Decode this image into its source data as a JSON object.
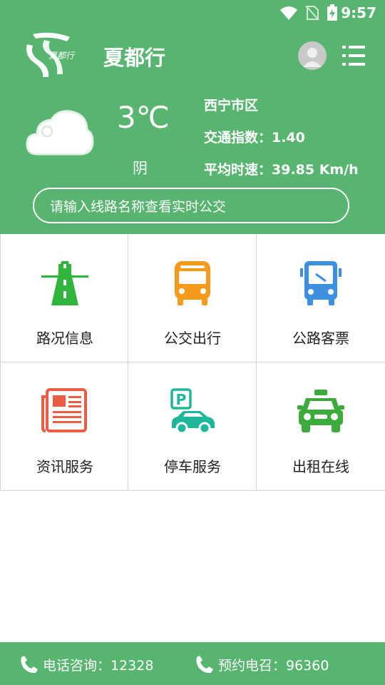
{
  "status_bar": {
    "time": "9:57"
  },
  "app": {
    "title": "夏都行",
    "logo_text": "夏都行"
  },
  "weather": {
    "temperature": "3℃",
    "condition": "阴",
    "icon": "cloud-icon"
  },
  "traffic": {
    "district": "西宁市区",
    "index_line": "交通指数：1.40",
    "speed_line": "平均时速：39.85 Km/h"
  },
  "search": {
    "placeholder": "请输入线路名称查看实时公交"
  },
  "grid": [
    {
      "label": "路况信息",
      "icon": "road-icon",
      "color": "#2fb53c"
    },
    {
      "label": "公交出行",
      "icon": "bus-icon",
      "color": "#f59a1b"
    },
    {
      "label": "公路客票",
      "icon": "coach-icon",
      "color": "#3d8fe0"
    },
    {
      "label": "资讯服务",
      "icon": "newspaper-icon",
      "color": "#ea5d43"
    },
    {
      "label": "停车服务",
      "icon": "parking-icon",
      "color": "#1fb79a"
    },
    {
      "label": "出租在线",
      "icon": "taxi-icon",
      "color": "#3cab3c"
    }
  ],
  "footer": {
    "hotline": "电话咨询：12328",
    "booking": "预约电召：96360"
  },
  "colors": {
    "primary": "#57b570"
  }
}
